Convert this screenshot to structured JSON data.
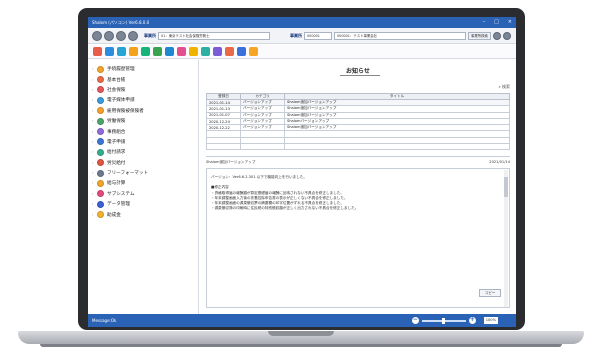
{
  "window": {
    "title": "Shalom (パソコン) Ver6.8.0.0",
    "controls": [
      "–",
      "□",
      "×"
    ]
  },
  "toolbar": {
    "office_label": "事業所",
    "office_value": "01：東京テスト社会保険労務士",
    "client_label": "事業所",
    "client_code": "000001",
    "client_name": "000001：テスト事業会社",
    "client_search_btn": "事業所検索",
    "icon_colors": [
      "#e85c4a",
      "#2d8be0",
      "#25a4d5",
      "#f2a21b",
      "#17b37a",
      "#3aa352",
      "#1e88d2",
      "#e34f8e",
      "#f0b400",
      "#2cb0a2",
      "#7b5bd6",
      "#e9694a",
      "#3b6fd9",
      "#f6a623"
    ]
  },
  "sidebar": {
    "items": [
      {
        "label": "手続履歴管理",
        "color": "#f1a52a"
      },
      {
        "label": "基本台帳",
        "color": "#e96a48"
      },
      {
        "label": "社会保険",
        "color": "#e25757"
      },
      {
        "label": "電子媒体申請",
        "color": "#3b9bd8"
      },
      {
        "label": "雇用保険被保険者",
        "color": "#f3a12b"
      },
      {
        "label": "労働保険",
        "color": "#4aa56a"
      },
      {
        "label": "事務組合",
        "color": "#8e6bd6"
      },
      {
        "label": "電子申請",
        "color": "#3c75d6"
      },
      {
        "label": "給付請求",
        "color": "#33ad8a"
      },
      {
        "label": "労災給付",
        "color": "#e0563f"
      },
      {
        "label": "フリーフォーマット",
        "color": "#6c7a8f"
      },
      {
        "label": "給与計算",
        "color": "#f1a52a"
      },
      {
        "label": "サブシステム",
        "color": "#e24a7c"
      },
      {
        "label": "データ管理",
        "color": "#3b5fd6"
      },
      {
        "label": "助成金",
        "color": "#f4b12c"
      }
    ]
  },
  "main": {
    "title": "お知らせ",
    "search_label": "検索",
    "columns": [
      "登録日",
      "カテゴリ",
      "タイトル"
    ],
    "rows": [
      [
        "2021-01-14",
        "バージョンアップ",
        "Shalom追加バージョンアップ"
      ],
      [
        "2021-01-13",
        "バージョンアップ",
        "Shalom追加バージョンアップ"
      ],
      [
        "2021-01-07",
        "バージョンアップ",
        "Shalom追加バージョンアップ"
      ],
      [
        "2020-12-24",
        "バージョンアップ",
        "Shalomバージョンアップ"
      ],
      [
        "2020-12-22",
        "バージョンアップ",
        "Shalom追加バージョンアップ"
      ]
    ],
    "detail_title": "Shalom追加バージョンアップ",
    "detail_date": "2021/01/14",
    "detail_lines": [
      "バージョン：Ver6.6.2.301 以下で機能向上を行いました。",
      "",
      "■修正内容",
      "・資格取得届の報酬額が算定基礎届の報酬に反映されない不具合を修正しました。",
      "・年末調整画面入力後の扶養控除申告書の表示が正しくない不具合を修正しました。",
      "・年末調整画面の源泉徴収票の摘要欄の印字位置がずれる不具合を修正しました。",
      "・源泉徴収簿の印刷時に住民税の特別徴収額が正しく出力されない不具合を修正しました。"
    ],
    "copy_button": "コピー"
  },
  "status": {
    "text": "Message:Ok",
    "zoom": "100%",
    "zoom_level": 0.5
  }
}
